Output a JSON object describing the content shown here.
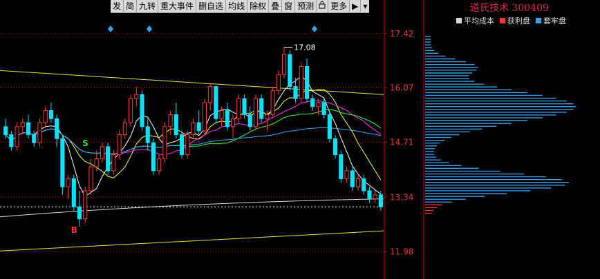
{
  "toolbar": {
    "items": [
      "发",
      "简",
      "九转",
      "重大事件",
      "删自选",
      "均线",
      "除权",
      "叠",
      "窗",
      "预测",
      "更多"
    ],
    "icons": [
      "lock-icon",
      "arrow-right-icon",
      "chevron-down-icon"
    ]
  },
  "stock": {
    "name": "道氏技术",
    "code": "300409"
  },
  "legend": [
    {
      "label": "平均成本",
      "color": "#d8d8d8"
    },
    {
      "label": "获利盘",
      "color": "#ff3333"
    },
    {
      "label": "套牢盘",
      "color": "#3aa0e6"
    }
  ],
  "colors": {
    "up": "#ff3d3d",
    "down": "#00e5ff",
    "axis": "#c8000a"
  },
  "chart_data": {
    "type": "candlestick",
    "y_ticks": [
      "17.42",
      "16.07",
      "14.71",
      "13.34",
      "11.98"
    ],
    "ylim": [
      11.3,
      17.95
    ],
    "candles": [
      [
        15.1,
        15.3,
        14.8,
        14.9
      ],
      [
        14.9,
        15.0,
        14.5,
        14.6
      ],
      [
        14.6,
        15.2,
        14.5,
        15.1
      ],
      [
        15.1,
        15.3,
        14.9,
        15.2
      ],
      [
        15.2,
        15.4,
        14.8,
        14.9
      ],
      [
        14.9,
        15.0,
        14.6,
        14.7
      ],
      [
        14.7,
        15.3,
        14.6,
        15.2
      ],
      [
        15.2,
        15.6,
        15.1,
        15.5
      ],
      [
        15.5,
        15.7,
        15.2,
        15.3
      ],
      [
        15.3,
        15.4,
        14.6,
        14.8
      ],
      [
        14.8,
        14.9,
        13.4,
        13.6
      ],
      [
        13.6,
        13.9,
        13.3,
        13.8
      ],
      [
        13.8,
        13.9,
        13.0,
        13.1
      ],
      [
        13.1,
        13.5,
        12.6,
        12.8
      ],
      [
        12.8,
        13.6,
        12.7,
        13.5
      ],
      [
        13.5,
        14.3,
        13.4,
        14.1
      ],
      [
        14.1,
        14.5,
        14.0,
        14.3
      ],
      [
        14.3,
        14.7,
        14.2,
        14.6
      ],
      [
        14.6,
        14.7,
        13.9,
        14.0
      ],
      [
        14.0,
        14.5,
        13.9,
        14.4
      ],
      [
        14.4,
        15.0,
        14.3,
        14.9
      ],
      [
        14.9,
        15.3,
        14.8,
        15.2
      ],
      [
        15.2,
        15.9,
        15.1,
        15.8
      ],
      [
        15.8,
        16.1,
        15.6,
        15.9
      ],
      [
        15.9,
        16.0,
        15.0,
        15.1
      ],
      [
        15.1,
        15.3,
        14.5,
        14.7
      ],
      [
        14.7,
        14.8,
        13.9,
        14.0
      ],
      [
        14.0,
        14.4,
        13.9,
        14.3
      ],
      [
        14.3,
        15.2,
        14.2,
        15.1
      ],
      [
        15.1,
        15.5,
        14.9,
        15.4
      ],
      [
        15.4,
        15.7,
        14.8,
        14.9
      ],
      [
        14.9,
        15.0,
        14.3,
        14.4
      ],
      [
        14.4,
        15.0,
        14.3,
        14.9
      ],
      [
        14.9,
        15.3,
        14.8,
        15.2
      ],
      [
        15.2,
        15.5,
        14.9,
        15.0
      ],
      [
        15.0,
        15.8,
        14.9,
        15.7
      ],
      [
        15.7,
        16.2,
        15.5,
        16.1
      ],
      [
        16.1,
        16.1,
        15.2,
        15.3
      ],
      [
        15.3,
        15.6,
        15.1,
        15.5
      ],
      [
        15.5,
        15.7,
        15.0,
        15.1
      ],
      [
        15.1,
        15.4,
        14.8,
        15.3
      ],
      [
        15.3,
        15.9,
        15.2,
        15.8
      ],
      [
        15.8,
        15.9,
        15.3,
        15.4
      ],
      [
        15.4,
        15.6,
        15.0,
        15.1
      ],
      [
        15.1,
        15.9,
        15.0,
        15.8
      ],
      [
        15.8,
        15.9,
        15.2,
        15.3
      ],
      [
        15.3,
        15.5,
        15.0,
        15.4
      ],
      [
        15.4,
        16.1,
        15.3,
        16.0
      ],
      [
        16.0,
        16.5,
        15.9,
        16.4
      ],
      [
        16.4,
        17.08,
        16.3,
        16.9
      ],
      [
        16.9,
        17.0,
        16.0,
        16.1
      ],
      [
        16.1,
        16.3,
        15.7,
        15.8
      ],
      [
        15.8,
        16.7,
        15.7,
        16.6
      ],
      [
        16.6,
        16.8,
        15.7,
        15.8
      ],
      [
        15.8,
        15.9,
        15.5,
        15.6
      ],
      [
        15.6,
        15.8,
        15.4,
        15.7
      ],
      [
        15.7,
        15.8,
        15.3,
        15.4
      ],
      [
        15.4,
        15.5,
        14.7,
        14.8
      ],
      [
        14.8,
        14.9,
        14.3,
        14.4
      ],
      [
        14.4,
        14.5,
        13.7,
        13.8
      ],
      [
        13.8,
        14.1,
        13.7,
        14.0
      ],
      [
        14.0,
        14.1,
        13.5,
        13.6
      ],
      [
        13.6,
        13.9,
        13.5,
        13.8
      ],
      [
        13.8,
        13.9,
        13.4,
        13.5
      ],
      [
        13.5,
        13.6,
        13.2,
        13.3
      ],
      [
        13.3,
        13.5,
        13.2,
        13.4
      ],
      [
        13.4,
        13.5,
        13.0,
        13.1
      ]
    ],
    "annotations": [
      {
        "text": "17.08",
        "value": 17.08
      },
      {
        "text": "S",
        "value": 14.62,
        "color": "#33dd33"
      },
      {
        "text": "B",
        "value": 12.45,
        "color": "#ff3333"
      }
    ],
    "chip_distribution": {
      "profit_color": "#ff3333",
      "trapped_color": "#3aa0e6",
      "avg_cost": 13.2
    }
  }
}
